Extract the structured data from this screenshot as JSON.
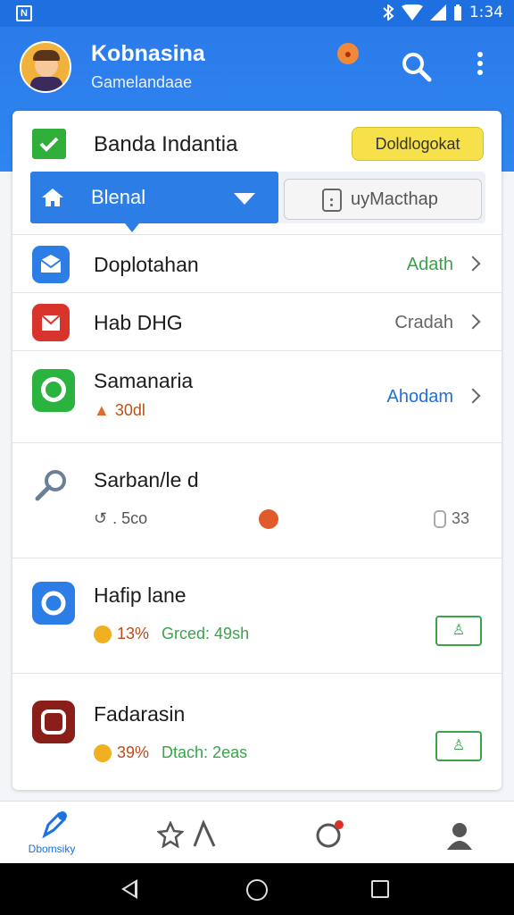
{
  "status_bar": {
    "left_icon": "N",
    "time": "1:34"
  },
  "app_bar": {
    "title": "Kobnasina",
    "subtitle": "Gamelandaae",
    "emoji": "😠"
  },
  "card": {
    "title": "Banda Indantia",
    "badge": "Doldlogokat",
    "dropdown_label": "Blenal",
    "secondary_button_label": "uyMacthap"
  },
  "rows": [
    {
      "name": "Doplotahan",
      "action": "Adath",
      "action_color": "#3aa34a"
    },
    {
      "name": "Hab DHG",
      "action": "Cradah",
      "action_color": "#666666"
    },
    {
      "name": "Samanaria",
      "meta": "30dl",
      "action": "Ahodam",
      "action_color": "#1e6fe0"
    },
    {
      "name": "Sarban/le d",
      "meta_left": ". 5co",
      "meta_right": "33"
    },
    {
      "name": "Hafip lane",
      "percent": "13%",
      "status": "Grced: 49sh",
      "button_glyph": "♙"
    },
    {
      "name": "Fadarasin",
      "percent": "39%",
      "status": "Dtach: 2eas",
      "button_glyph": "♙"
    }
  ],
  "bottom_nav": {
    "active_label": "Dbomsiky"
  },
  "colors": {
    "primary": "#2c7de6",
    "green": "#3aa34a",
    "orange": "#e08a1a"
  }
}
